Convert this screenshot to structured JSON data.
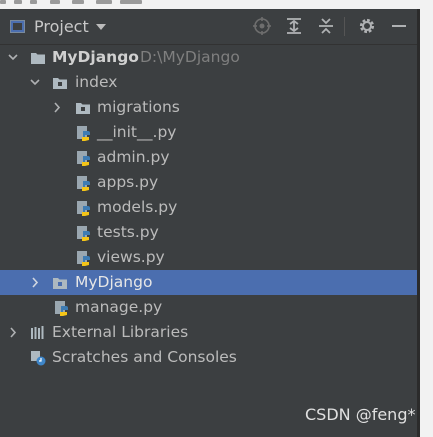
{
  "toolwindow": {
    "title": "Project",
    "buttons": [
      {
        "name": "locate-icon"
      },
      {
        "name": "expand-all-icon"
      },
      {
        "name": "collapse-all-icon"
      },
      {
        "name": "settings-icon"
      },
      {
        "name": "hide-icon"
      }
    ]
  },
  "tree": {
    "root_name": "MyDjango",
    "root_path": "D:\\MyDjango",
    "index_folder": "index",
    "migrations_folder": "migrations",
    "files_index": [
      "__init__.py",
      "admin.py",
      "apps.py",
      "models.py",
      "tests.py",
      "views.py"
    ],
    "mydjango_folder": "MyDjango",
    "manage_file": "manage.py",
    "external_libraries": "External Libraries",
    "scratches": "Scratches and Consoles"
  },
  "watermark": "CSDN @feng*",
  "colors": {
    "background": "#3c3f41",
    "selection": "#4b6eaf",
    "text": "#bbbbbb",
    "path": "#7f7f7f"
  }
}
